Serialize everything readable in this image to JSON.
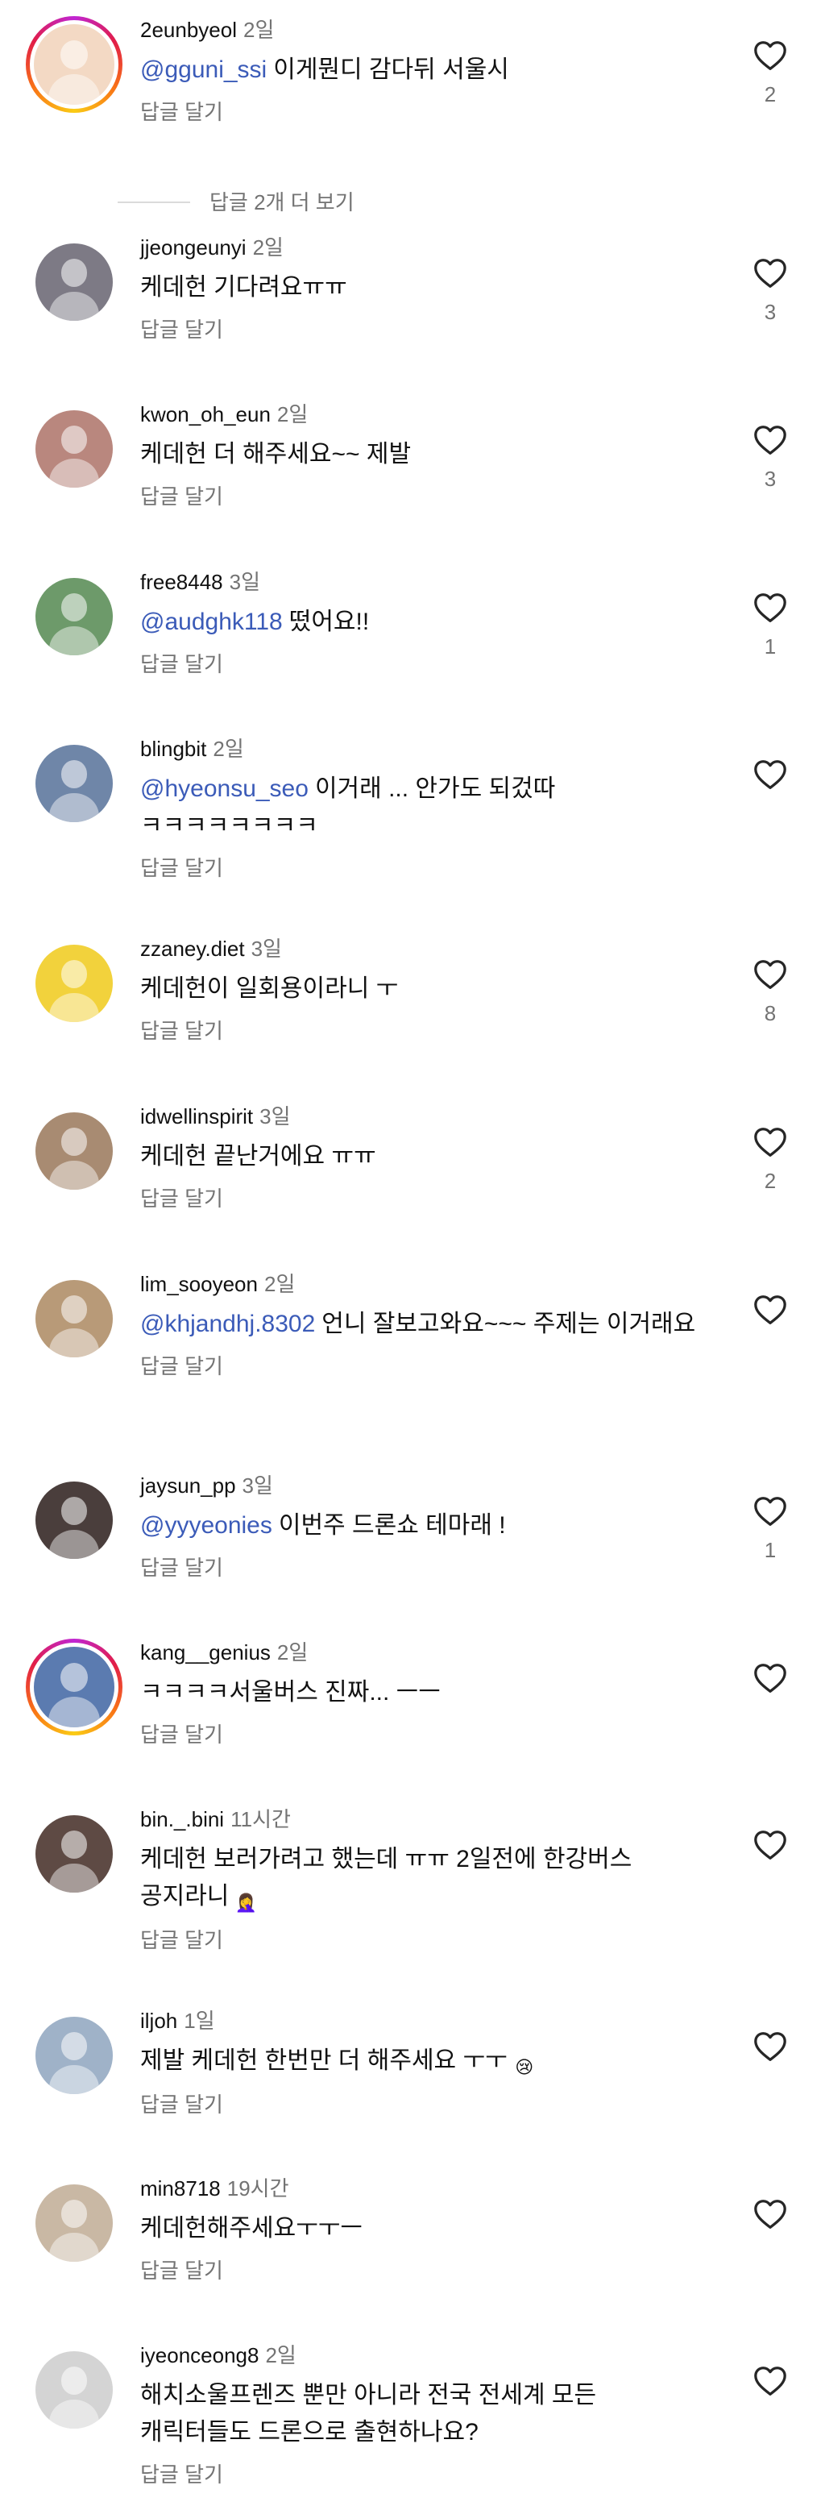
{
  "reply_label": "답글 달기",
  "heart_icon": "heart-outline-icon",
  "comments": [
    {
      "username": "2eunbyeol",
      "time": "2일",
      "mention": "@gguni_ssi",
      "text": "이게뭔디 감다뒤 서울시",
      "likes": "2",
      "story": true,
      "avatar_color": "#f3d9c4",
      "more_replies": "답글 2개 더 보기"
    },
    {
      "username": "jjeongeunyi",
      "time": "2일",
      "mention": "",
      "text": "케데헌 기다려요ㅠㅠ",
      "likes": "3",
      "story": false,
      "avatar_color": "#7d7a85"
    },
    {
      "username": "kwon_oh_eun",
      "time": "2일",
      "mention": "",
      "text": "케데헌 더 해주세요~~ 제발",
      "likes": "3",
      "story": false,
      "avatar_color": "#b9877e"
    },
    {
      "username": "free8448",
      "time": "3일",
      "mention": "@audghk118",
      "text": "떴어요!!",
      "likes": "1",
      "story": false,
      "avatar_color": "#6d9a6a"
    },
    {
      "username": "blingbit",
      "time": "2일",
      "mention": "@hyeonsu_seo",
      "text": "이거래 ... 안가도 되겄따 ㅋㅋㅋㅋㅋㅋㅋㅋ",
      "likes": "",
      "story": false,
      "avatar_color": "#6f86a8"
    },
    {
      "username": "zzaney.diet",
      "time": "3일",
      "mention": "",
      "text": "케데헌이 일회용이라니 ㅜ",
      "likes": "8",
      "story": false,
      "avatar_color": "#f2d23c"
    },
    {
      "username": "idwellinspirit",
      "time": "3일",
      "mention": "",
      "text": "케데헌 끝난거에요 ㅠㅠ",
      "likes": "2",
      "story": false,
      "avatar_color": "#a88b72"
    },
    {
      "username": "lim_sooyeon",
      "time": "2일",
      "mention": "@khjandhj.8302",
      "text": "언니 잘보고와요~~~ 주제는 이거래요",
      "likes": "",
      "story": false,
      "avatar_color": "#b89a78"
    },
    {
      "username": "jaysun_pp",
      "time": "3일",
      "mention": "@yyyeonies",
      "text": "이번주 드론쇼 테마래 !",
      "likes": "1",
      "story": false,
      "avatar_color": "#4a3e3c"
    },
    {
      "username": "kang__genius",
      "time": "2일",
      "mention": "",
      "text": "ㅋㅋㅋㅋ서울버스 진짜... ㅡㅡ",
      "likes": "",
      "story": true,
      "avatar_color": "#5b7bb0"
    },
    {
      "username": "bin._.bini",
      "time": "11시간",
      "mention": "",
      "text": "케데헌 보러가려고 했는데 ㅠㅠ 2일전에 한강버스 공지라니",
      "likes": "",
      "story": false,
      "avatar_color": "#5e4a44",
      "emoji": "🤦‍♀️"
    },
    {
      "username": "iljoh",
      "time": "1일",
      "mention": "",
      "text": "제발 케데헌 한번만 더 해주세요 ㅜㅜ",
      "likes": "",
      "story": false,
      "avatar_color": "#9fb2c8",
      "emoji": "😢"
    },
    {
      "username": "min8718",
      "time": "19시간",
      "mention": "",
      "text": "케데헌해주세요ㅜㅜㅡ",
      "likes": "",
      "story": false,
      "avatar_color": "#c9b8a4"
    },
    {
      "username": "iyeonceong8",
      "time": "2일",
      "mention": "",
      "text": "해치소울프렌즈 뿐만 아니라 전국 전세계 모든 캐릭터들도 드론으로 출현하나요?",
      "likes": "",
      "story": false,
      "avatar_color": "#d4d4d4"
    }
  ]
}
